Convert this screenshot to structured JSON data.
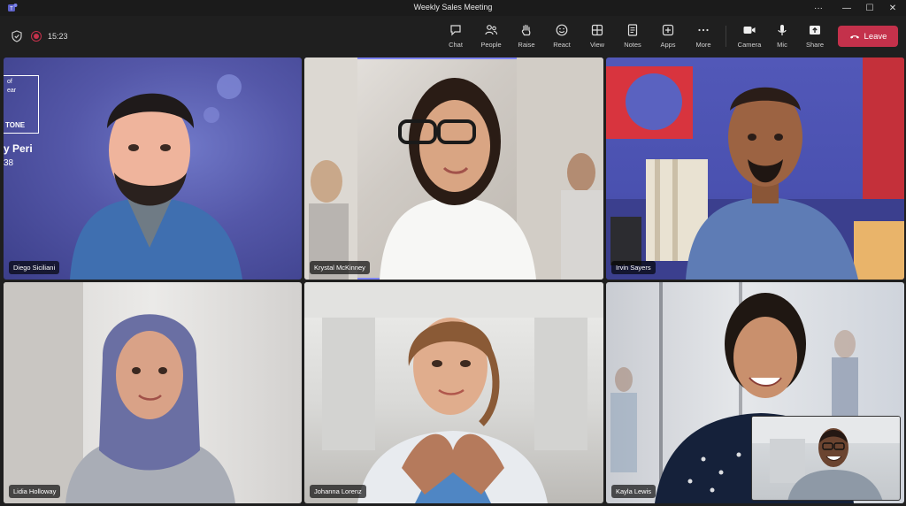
{
  "window": {
    "title": "Weekly Sales Meeting",
    "minimize": "—",
    "maximize": "☐",
    "close": "✕",
    "more": "···"
  },
  "meeting": {
    "timer": "15:23"
  },
  "toolbar": {
    "chat": "Chat",
    "people": "People",
    "raise": "Raise",
    "react": "React",
    "view": "View",
    "notes": "Notes",
    "apps": "Apps",
    "more": "More",
    "camera": "Camera",
    "mic": "Mic",
    "share": "Share",
    "leave": "Leave"
  },
  "colors": {
    "accent": "#7f85f5",
    "leave": "#c4314b",
    "background": "#1f1f1f"
  },
  "participants": [
    {
      "name": "Diego Siciliani"
    },
    {
      "name": "Krystal McKinney",
      "active": true
    },
    {
      "name": "Irvin Sayers"
    },
    {
      "name": "Lidia Holloway"
    },
    {
      "name": "Johanna Lorenz"
    },
    {
      "name": "Kayla Lewis"
    }
  ],
  "backdrop": {
    "line1": "of",
    "line2": "ear",
    "line3": "TONE",
    "line4": "y Peri",
    "line5": "38"
  }
}
